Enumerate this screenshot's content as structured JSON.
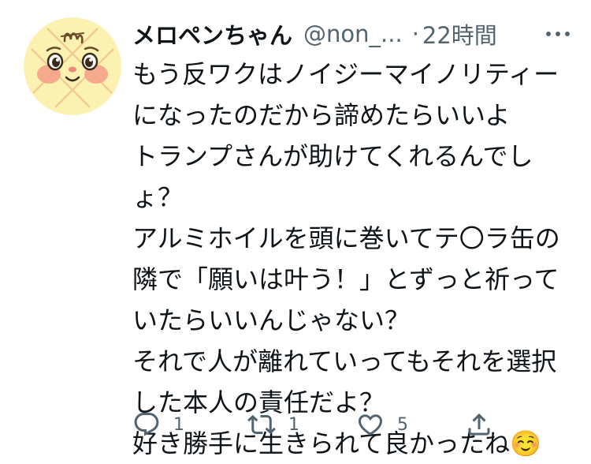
{
  "user": {
    "display_name": "メロペンちゃん",
    "handle": "@non_...",
    "separator": "·",
    "time": "22時間"
  },
  "tweet": {
    "lines": [
      "もう反ワクはノイジーマイノリティー",
      "になったのだから諦めたらいいよ",
      "トランプさんが助けてくれるんでし",
      "ょ？",
      "アルミホイルを頭に巻いてテ〇ラ缶の",
      "隣で「願いは叶う！」とずっと祈って",
      "いたらいいんじゃない？",
      "それで人が離れていってもそれを選択",
      "した本人の責任だよ？",
      "好き勝手に生きられて良かったね☺️"
    ]
  },
  "actions": {
    "reply": {
      "icon": "reply-icon",
      "count": "1"
    },
    "retweet": {
      "icon": "retweet-icon",
      "count": "1"
    },
    "like": {
      "icon": "heart-icon",
      "count": "5"
    },
    "share": {
      "icon": "share-icon"
    }
  },
  "colors": {
    "text": "#0f1419",
    "secondary": "#536471",
    "avatar_bg": "#fbf1b0"
  }
}
